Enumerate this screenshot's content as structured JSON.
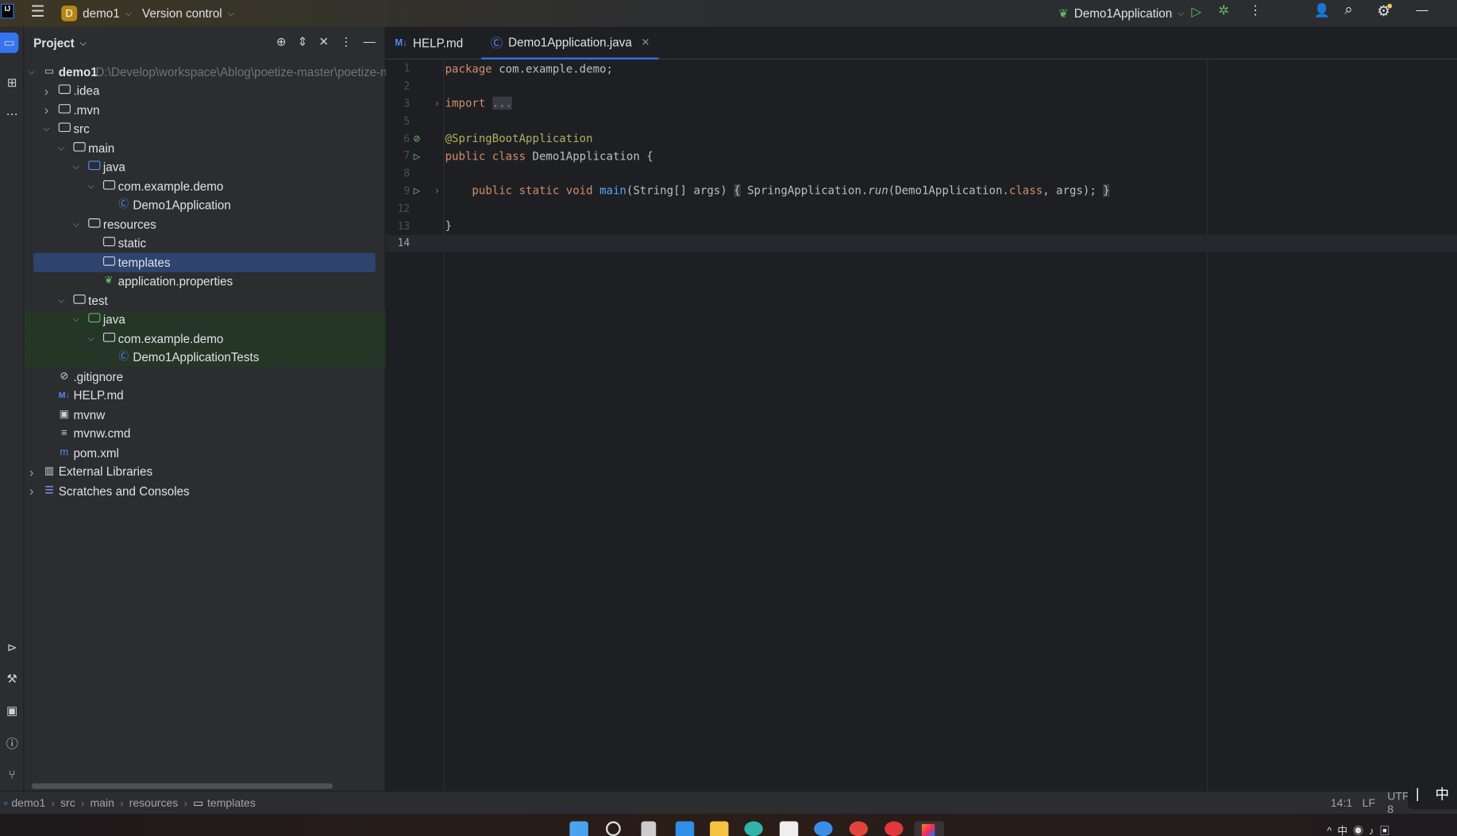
{
  "titlebar": {
    "project": "demo1",
    "project_initial": "D",
    "vcs": "Version control",
    "run_config": "Demo1Application"
  },
  "panel": {
    "title": "Project"
  },
  "tree": [
    {
      "level": 0,
      "exp": "open",
      "icon": "module-folder-icon",
      "label": "demo1",
      "path": "D:\\Develop\\workspace\\Ablog\\poetize-master\\poetize-master",
      "bold": true
    },
    {
      "level": 1,
      "exp": "closed",
      "icon": "folder-icon",
      "label": ".idea"
    },
    {
      "level": 1,
      "exp": "closed",
      "icon": "folder-icon",
      "label": ".mvn"
    },
    {
      "level": 1,
      "exp": "open",
      "icon": "folder-icon",
      "label": "src"
    },
    {
      "level": 2,
      "exp": "open",
      "icon": "folder-icon",
      "label": "main"
    },
    {
      "level": 3,
      "exp": "open",
      "icon": "source-folder-icon",
      "label": "java"
    },
    {
      "level": 4,
      "exp": "open",
      "icon": "package-icon",
      "label": "com.example.demo"
    },
    {
      "level": 5,
      "exp": "none",
      "icon": "spring-class-icon",
      "label": "Demo1Application"
    },
    {
      "level": 3,
      "exp": "open",
      "icon": "resources-folder-icon",
      "label": "resources"
    },
    {
      "level": 4,
      "exp": "none",
      "icon": "folder-icon",
      "label": "static"
    },
    {
      "level": 4,
      "exp": "none",
      "icon": "folder-icon",
      "label": "templates",
      "selected": true
    },
    {
      "level": 4,
      "exp": "none",
      "icon": "spring-properties-icon",
      "label": "application.properties"
    },
    {
      "level": 2,
      "exp": "open",
      "icon": "folder-icon",
      "label": "test"
    },
    {
      "level": 3,
      "exp": "open",
      "icon": "test-folder-icon",
      "label": "java",
      "green": true
    },
    {
      "level": 4,
      "exp": "open",
      "icon": "package-icon",
      "label": "com.example.demo",
      "green": true
    },
    {
      "level": 5,
      "exp": "none",
      "icon": "class-icon",
      "label": "Demo1ApplicationTests",
      "green": true
    },
    {
      "level": 1,
      "exp": "none",
      "icon": "ignore-file-icon",
      "label": ".gitignore"
    },
    {
      "level": 1,
      "exp": "none",
      "icon": "markdown-icon",
      "label": "HELP.md"
    },
    {
      "level": 1,
      "exp": "none",
      "icon": "shell-script-icon",
      "label": "mvnw"
    },
    {
      "level": 1,
      "exp": "none",
      "icon": "text-file-icon",
      "label": "mvnw.cmd"
    },
    {
      "level": 1,
      "exp": "none",
      "icon": "maven-icon",
      "label": "pom.xml"
    },
    {
      "level": 0,
      "exp": "closed",
      "icon": "library-icon",
      "label": "External Libraries"
    },
    {
      "level": 0,
      "exp": "closed",
      "icon": "scratches-icon",
      "label": "Scratches and Consoles"
    }
  ],
  "tabs": [
    {
      "label": "HELP.md",
      "icon": "markdown-icon",
      "active": false
    },
    {
      "label": "Demo1Application.java",
      "icon": "spring-class-icon",
      "active": true
    }
  ],
  "code": [
    {
      "n": "1",
      "tokens": [
        [
          "kw",
          "package "
        ],
        [
          "",
          "com.example.demo;"
        ]
      ]
    },
    {
      "n": "2",
      "tokens": []
    },
    {
      "n": "3",
      "fold": true,
      "tokens": [
        [
          "kw",
          "import "
        ],
        [
          "fold",
          "..."
        ]
      ]
    },
    {
      "n": "5",
      "tokens": []
    },
    {
      "n": "6",
      "gutter": "spring-bean-icon",
      "tokens": [
        [
          "ann",
          "@SpringBootApplication"
        ]
      ]
    },
    {
      "n": "7",
      "gutter": "run-icon",
      "tokens": [
        [
          "kw",
          "public class "
        ],
        [
          "",
          "Demo1Application {"
        ]
      ]
    },
    {
      "n": "8",
      "tokens": []
    },
    {
      "n": "9",
      "gutter": "run-icon",
      "fold": true,
      "tokens": [
        [
          "",
          "    "
        ],
        [
          "kw",
          "public static void "
        ],
        [
          "fn",
          "main"
        ],
        [
          "",
          "(String[] args) "
        ],
        [
          "br",
          "{"
        ],
        [
          "",
          " SpringApplication."
        ],
        [
          "it",
          "run"
        ],
        [
          "",
          "(Demo1Application."
        ],
        [
          "kw",
          "class"
        ],
        [
          "",
          ", args); "
        ],
        [
          "br",
          "}"
        ]
      ]
    },
    {
      "n": "12",
      "tokens": []
    },
    {
      "n": "13",
      "tokens": [
        [
          "",
          "}"
        ]
      ]
    },
    {
      "n": "14",
      "current": true,
      "tokens": []
    }
  ],
  "statusbar": {
    "breadcrumbs": [
      "demo1",
      "src",
      "main",
      "resources",
      "templates"
    ],
    "position": "14:1",
    "line_sep": "LF",
    "encoding": "UTF-8",
    "ime": "中"
  },
  "colors": {
    "accent": "#3574f0",
    "selection": "#2e436e",
    "keyword": "#cf8e6d",
    "annotation": "#b3ae60",
    "run": "#5fb865"
  }
}
